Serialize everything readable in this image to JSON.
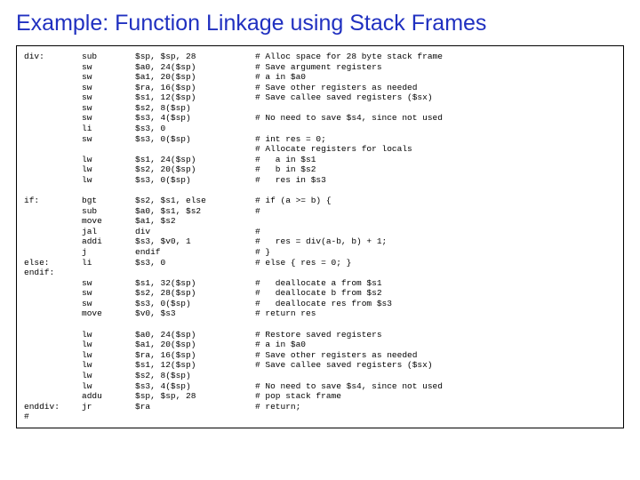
{
  "title": "Example: Function Linkage using Stack Frames",
  "rows": [
    {
      "lbl": "div:",
      "op": "sub",
      "arg": "$sp, $sp, 28",
      "cmt": "# Alloc space for 28 byte stack frame"
    },
    {
      "lbl": "",
      "op": "sw",
      "arg": "$a0, 24($sp)",
      "cmt": "# Save argument registers"
    },
    {
      "lbl": "",
      "op": "sw",
      "arg": "$a1, 20($sp)",
      "cmt": "# a in $a0"
    },
    {
      "lbl": "",
      "op": "sw",
      "arg": "$ra, 16($sp)",
      "cmt": "# Save other registers as needed"
    },
    {
      "lbl": "",
      "op": "sw",
      "arg": "$s1, 12($sp)",
      "cmt": "# Save callee saved registers ($sx)"
    },
    {
      "lbl": "",
      "op": "sw",
      "arg": "$s2, 8($sp)",
      "cmt": ""
    },
    {
      "lbl": "",
      "op": "sw",
      "arg": "$s3, 4($sp)",
      "cmt": "# No need to save $s4, since not used"
    },
    {
      "lbl": "",
      "op": "li",
      "arg": "$s3, 0",
      "cmt": ""
    },
    {
      "lbl": "",
      "op": "sw",
      "arg": "$s3, 0($sp)",
      "cmt": "# int res = 0;"
    },
    {
      "lbl": "",
      "op": "",
      "arg": "",
      "cmt": "# Allocate registers for locals"
    },
    {
      "lbl": "",
      "op": "lw",
      "arg": "$s1, 24($sp)",
      "cmt": "#   a in $s1"
    },
    {
      "lbl": "",
      "op": "lw",
      "arg": "$s2, 20($sp)",
      "cmt": "#   b in $s2"
    },
    {
      "lbl": "",
      "op": "lw",
      "arg": "$s3, 0($sp)",
      "cmt": "#   res in $s3"
    },
    {
      "blank": true
    },
    {
      "lbl": "if:",
      "op": "bgt",
      "arg": "$s2, $s1, else",
      "cmt": "# if (a >= b) {"
    },
    {
      "lbl": "",
      "op": "sub",
      "arg": "$a0, $s1, $s2",
      "cmt": "#"
    },
    {
      "lbl": "",
      "op": "move",
      "arg": "$a1, $s2",
      "cmt": ""
    },
    {
      "lbl": "",
      "op": "jal",
      "arg": "div",
      "cmt": "#"
    },
    {
      "lbl": "",
      "op": "addi",
      "arg": "$s3, $v0, 1",
      "cmt": "#   res = div(a-b, b) + 1;"
    },
    {
      "lbl": "",
      "op": "j",
      "arg": "endif",
      "cmt": "# }"
    },
    {
      "lbl": "else:",
      "op": "li",
      "arg": "$s3, 0",
      "cmt": "# else { res = 0; }"
    },
    {
      "lbl": "endif:",
      "op": "",
      "arg": "",
      "cmt": ""
    },
    {
      "lbl": "",
      "op": "sw",
      "arg": "$s1, 32($sp)",
      "cmt": "#   deallocate a from $s1"
    },
    {
      "lbl": "",
      "op": "sw",
      "arg": "$s2, 28($sp)",
      "cmt": "#   deallocate b from $s2"
    },
    {
      "lbl": "",
      "op": "sw",
      "arg": "$s3, 0($sp)",
      "cmt": "#   deallocate res from $s3"
    },
    {
      "lbl": "",
      "op": "move",
      "arg": "$v0, $s3",
      "cmt": "# return res"
    },
    {
      "blank": true
    },
    {
      "lbl": "",
      "op": "lw",
      "arg": "$a0, 24($sp)",
      "cmt": "# Restore saved registers"
    },
    {
      "lbl": "",
      "op": "lw",
      "arg": "$a1, 20($sp)",
      "cmt": "# a in $a0"
    },
    {
      "lbl": "",
      "op": "lw",
      "arg": "$ra, 16($sp)",
      "cmt": "# Save other registers as needed"
    },
    {
      "lbl": "",
      "op": "lw",
      "arg": "$s1, 12($sp)",
      "cmt": "# Save callee saved registers ($sx)"
    },
    {
      "lbl": "",
      "op": "lw",
      "arg": "$s2, 8($sp)",
      "cmt": ""
    },
    {
      "lbl": "",
      "op": "lw",
      "arg": "$s3, 4($sp)",
      "cmt": "# No need to save $s4, since not used"
    },
    {
      "lbl": "",
      "op": "addu",
      "arg": "$sp, $sp, 28",
      "cmt": "# pop stack frame"
    },
    {
      "lbl": "enddiv:",
      "op": "jr",
      "arg": "$ra",
      "cmt": "# return;"
    },
    {
      "lbl": "#",
      "op": "",
      "arg": "",
      "cmt": ""
    }
  ]
}
